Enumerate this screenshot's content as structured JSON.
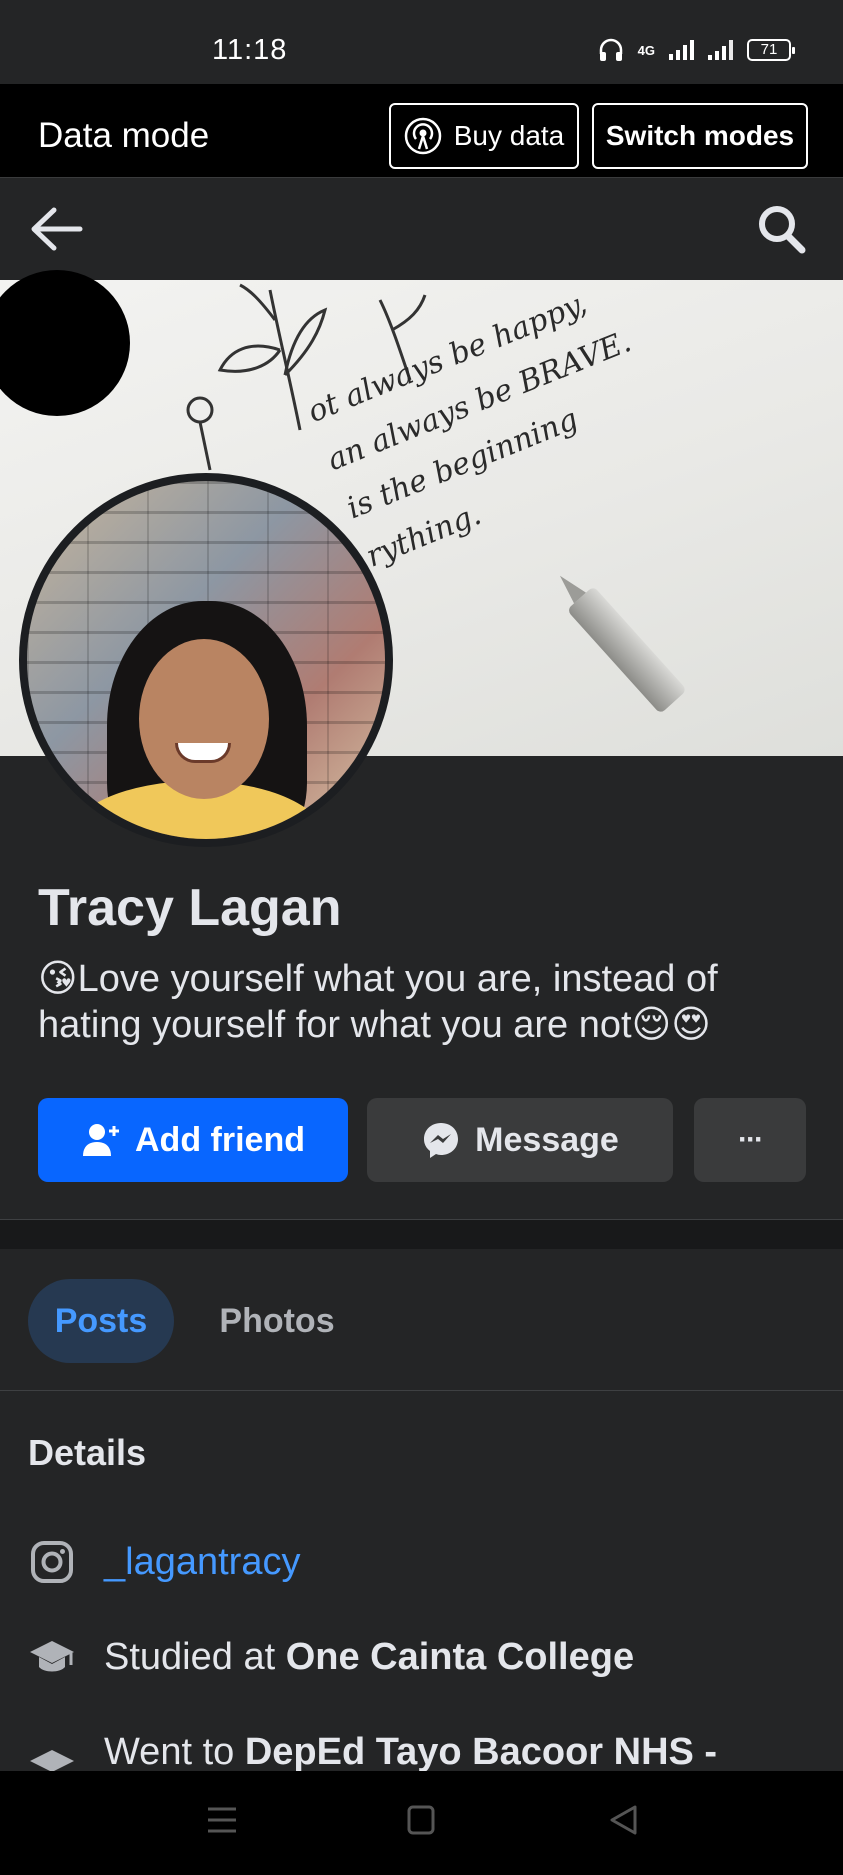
{
  "status_bar": {
    "time": "11:18",
    "network": "4G",
    "battery": "71"
  },
  "data_mode": {
    "label": "Data mode",
    "buy_data": "Buy data",
    "switch_modes": "Switch modes"
  },
  "cover": {
    "quote_lines": [
      "ot always be happy,",
      "an always be BRAVE.",
      "is the beginning",
      "rything."
    ]
  },
  "profile": {
    "name": "Tracy Lagan",
    "bio_emoji_start": "😘",
    "bio_text": "Love yourself what you are, instead of hating yourself for what you are not",
    "bio_emoji_end": "😌😍"
  },
  "actions": {
    "add_friend": "Add friend",
    "message": "Message",
    "more": "···"
  },
  "tabs": {
    "posts": "Posts",
    "photos": "Photos"
  },
  "details": {
    "title": "Details",
    "instagram": "_lagantracy",
    "studied_prefix": "Studied at ",
    "studied_school": "One Cainta College",
    "went_prefix": "Went to ",
    "went_school": "DepEd Tayo Bacoor NHS -"
  },
  "colors": {
    "accent_blue": "#0866ff",
    "link_blue": "#4599ff",
    "background": "#242526"
  }
}
